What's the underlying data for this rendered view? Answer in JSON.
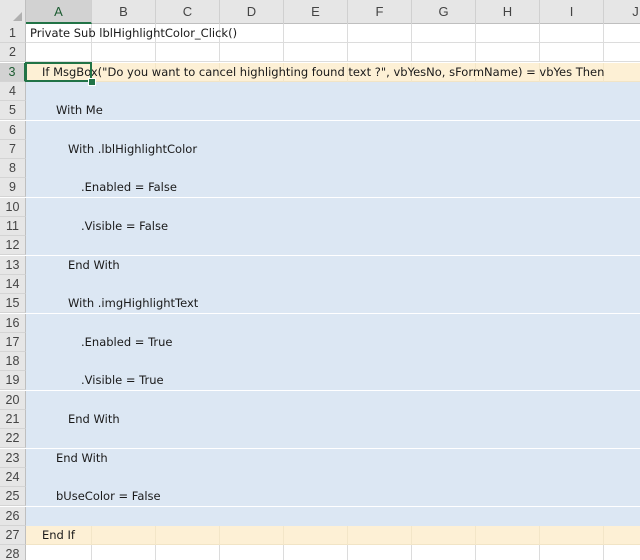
{
  "columns": [
    "A",
    "B",
    "C",
    "D",
    "E",
    "F",
    "G",
    "H",
    "I",
    "J"
  ],
  "active_column": "A",
  "active_row": "3",
  "rows": [
    {
      "num": "1",
      "text": "Private Sub lblHighlightColor_Click()",
      "fill": "white",
      "indent": 0
    },
    {
      "num": "2",
      "text": "",
      "fill": "white",
      "indent": 0
    },
    {
      "num": "3",
      "text": "If MsgBox(\"Do you want to cancel highlighting found text ?\", vbYesNo, sFormName) = vbYes Then",
      "fill": "yellow",
      "indent": 1
    },
    {
      "num": "4",
      "text": "",
      "fill": "blue",
      "indent": 0
    },
    {
      "num": "5",
      "text": "With Me",
      "fill": "blue",
      "indent": 2
    },
    {
      "num": "6",
      "text": "",
      "fill": "blue",
      "indent": 0
    },
    {
      "num": "7",
      "text": "With .lblHighlightColor",
      "fill": "blue",
      "indent": 3
    },
    {
      "num": "8",
      "text": "",
      "fill": "blue",
      "indent": 0
    },
    {
      "num": "9",
      "text": ".Enabled = False",
      "fill": "blue",
      "indent": 4
    },
    {
      "num": "10",
      "text": "",
      "fill": "blue",
      "indent": 0
    },
    {
      "num": "11",
      "text": ".Visible = False",
      "fill": "blue",
      "indent": 4
    },
    {
      "num": "12",
      "text": "",
      "fill": "blue",
      "indent": 0
    },
    {
      "num": "13",
      "text": "End With",
      "fill": "blue",
      "indent": 3
    },
    {
      "num": "14",
      "text": "",
      "fill": "blue",
      "indent": 0
    },
    {
      "num": "15",
      "text": "With .imgHighlightText",
      "fill": "blue",
      "indent": 3
    },
    {
      "num": "16",
      "text": "",
      "fill": "blue",
      "indent": 0
    },
    {
      "num": "17",
      "text": ".Enabled = True",
      "fill": "blue",
      "indent": 4
    },
    {
      "num": "18",
      "text": "",
      "fill": "blue",
      "indent": 0
    },
    {
      "num": "19",
      "text": ".Visible = True",
      "fill": "blue",
      "indent": 4
    },
    {
      "num": "20",
      "text": "",
      "fill": "blue",
      "indent": 0
    },
    {
      "num": "21",
      "text": "End With",
      "fill": "blue",
      "indent": 3
    },
    {
      "num": "22",
      "text": "",
      "fill": "blue",
      "indent": 0
    },
    {
      "num": "23",
      "text": "End With",
      "fill": "blue",
      "indent": 2
    },
    {
      "num": "24",
      "text": "",
      "fill": "blue",
      "indent": 0
    },
    {
      "num": "25",
      "text": "bUseColor = False",
      "fill": "blue",
      "indent": 2
    },
    {
      "num": "26",
      "text": "",
      "fill": "blue",
      "indent": 0
    },
    {
      "num": "27",
      "text": "End If",
      "fill": "yellow",
      "indent": 1
    },
    {
      "num": "28",
      "text": "",
      "fill": "white",
      "indent": 0
    }
  ],
  "colors": {
    "selection": "#217346",
    "block_fill": "#dce7f3",
    "condition_fill": "#fdf0d5",
    "header_fill": "#e6e6e6"
  }
}
